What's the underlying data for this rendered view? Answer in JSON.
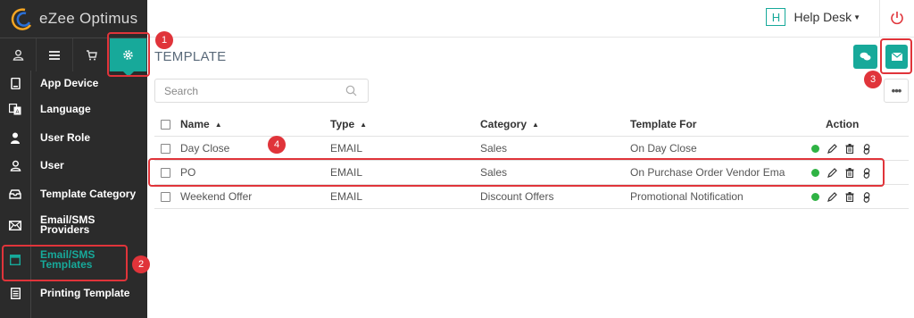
{
  "app": {
    "brand": "eZee Optimus"
  },
  "header": {
    "helpdesk_badge": "H",
    "helpdesk_label": "Help Desk"
  },
  "topnav": [
    "user-icon",
    "menu-icon",
    "cart-icon",
    "gear-icon"
  ],
  "sidebar": {
    "items": [
      {
        "label": "App Device",
        "icon": "tablet-icon"
      },
      {
        "label": "Language",
        "icon": "translate-icon"
      },
      {
        "label": "User Role",
        "icon": "person-icon"
      },
      {
        "label": "User",
        "icon": "user-outline-icon"
      },
      {
        "label": "Template Category",
        "icon": "inbox-icon"
      },
      {
        "label": "Email/SMS Providers",
        "icon": "envelope-icon"
      },
      {
        "label": "Email/SMS Templates",
        "icon": "calendar-icon",
        "selected": true
      },
      {
        "label": "Printing Template",
        "icon": "document-icon"
      }
    ]
  },
  "main": {
    "title": "TEMPLATE",
    "search_placeholder": "Search",
    "more_label": "•••"
  },
  "table": {
    "columns": [
      "Name",
      "Type",
      "Category",
      "Template For",
      "Action"
    ],
    "rows": [
      {
        "name": "Day Close",
        "type": "EMAIL",
        "category": "Sales",
        "template_for": "On Day Close"
      },
      {
        "name": "PO",
        "type": "EMAIL",
        "category": "Sales",
        "template_for": "On Purchase Order Vendor Ema"
      },
      {
        "name": "Weekend Offer",
        "type": "EMAIL",
        "category": "Discount Offers",
        "template_for": "Promotional Notification"
      }
    ]
  },
  "annotations": [
    "1",
    "2",
    "3",
    "4"
  ],
  "colors": {
    "accent": "#17a99a",
    "annotation": "#e0343a",
    "sidebar": "#2b2b2b",
    "status": "#2fb344"
  }
}
